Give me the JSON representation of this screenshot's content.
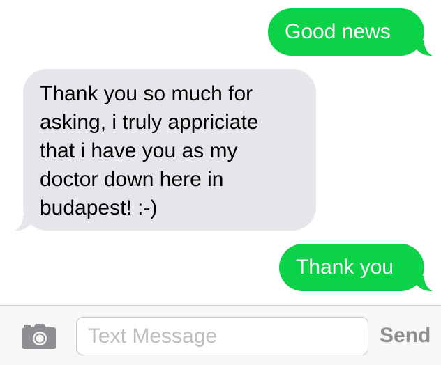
{
  "messages": [
    {
      "direction": "sent",
      "text": "Good news"
    },
    {
      "direction": "received",
      "text": "Thank you so much for\nasking, i truly appriciate\nthat i have you as my\ndoctor down here in\nbudapest! :-)"
    },
    {
      "direction": "sent",
      "text": "Thank you"
    }
  ],
  "input_bar": {
    "camera_icon": "camera-icon",
    "placeholder": "Text Message",
    "value": "",
    "send_label": "Send"
  },
  "colors": {
    "sent_bubble": "#0bd247",
    "received_bubble": "#e5e5ea",
    "send_disabled": "#8e8e93",
    "placeholder": "#bdbdc2"
  }
}
